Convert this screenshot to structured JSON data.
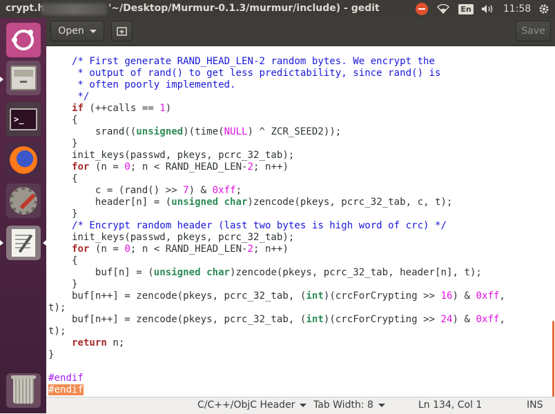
{
  "topbar": {
    "title_left": "crypt.h",
    "title_path": "'~/Desktop/Murmur-0.1.3/murmur/include) - gedit",
    "wifi_icon": "wifi-icon",
    "lang": "En",
    "volume_icon": "volume-icon",
    "clock": "11:58",
    "gear_icon": "gear-icon"
  },
  "toolbar": {
    "open_label": "Open",
    "new_icon": "new-tab-icon",
    "save_label": "Save"
  },
  "launcher": {
    "items": [
      "ubuntu-dash",
      "files",
      "terminal",
      "firefox",
      "system-settings",
      "text-editor",
      "trash"
    ]
  },
  "editor": {
    "lines": [
      [
        {
          "t": "    "
        },
        {
          "c": "cm",
          "t": "/* First generate RAND_HEAD_LEN-2 random bytes. We encrypt the"
        }
      ],
      [
        {
          "c": "cm",
          "t": "     * output of rand() to get less predictability, since rand() is"
        }
      ],
      [
        {
          "c": "cm",
          "t": "     * often poorly implemented."
        }
      ],
      [
        {
          "c": "cm",
          "t": "     */"
        }
      ],
      [
        {
          "t": "    "
        },
        {
          "c": "kw",
          "t": "if"
        },
        {
          "t": " (++calls == "
        },
        {
          "c": "nm",
          "t": "1"
        },
        {
          "t": ")"
        }
      ],
      [
        {
          "t": "    {"
        }
      ],
      [
        {
          "t": "        srand(("
        },
        {
          "c": "ty",
          "t": "unsigned"
        },
        {
          "t": ")(time("
        },
        {
          "c": "nm",
          "t": "NULL"
        },
        {
          "t": ") ^ ZCR_SEED2));"
        }
      ],
      [
        {
          "t": "    }"
        }
      ],
      [
        {
          "t": "    init_keys(passwd, pkeys, pcrc_32_tab);"
        }
      ],
      [
        {
          "t": "    "
        },
        {
          "c": "kw",
          "t": "for"
        },
        {
          "t": " (n = "
        },
        {
          "c": "nm",
          "t": "0"
        },
        {
          "t": "; n < RAND_HEAD_LEN-"
        },
        {
          "c": "nm",
          "t": "2"
        },
        {
          "t": "; n++)"
        }
      ],
      [
        {
          "t": "    {"
        }
      ],
      [
        {
          "t": "        c = (rand() >> "
        },
        {
          "c": "nm",
          "t": "7"
        },
        {
          "t": ") & "
        },
        {
          "c": "nm",
          "t": "0xff"
        },
        {
          "t": ";"
        }
      ],
      [
        {
          "t": "        header[n] = ("
        },
        {
          "c": "ty",
          "t": "unsigned char"
        },
        {
          "t": ")zencode(pkeys, pcrc_32_tab, c, t);"
        }
      ],
      [
        {
          "t": "    }"
        }
      ],
      [
        {
          "t": "    "
        },
        {
          "c": "cm",
          "t": "/* Encrypt random header (last two bytes is high word of crc) */"
        }
      ],
      [
        {
          "t": "    init_keys(passwd, pkeys, pcrc_32_tab);"
        }
      ],
      [
        {
          "t": "    "
        },
        {
          "c": "kw",
          "t": "for"
        },
        {
          "t": " (n = "
        },
        {
          "c": "nm",
          "t": "0"
        },
        {
          "t": "; n < RAND_HEAD_LEN-"
        },
        {
          "c": "nm",
          "t": "2"
        },
        {
          "t": "; n++)"
        }
      ],
      [
        {
          "t": "    {"
        }
      ],
      [
        {
          "t": "        buf[n] = ("
        },
        {
          "c": "ty",
          "t": "unsigned char"
        },
        {
          "t": ")zencode(pkeys, pcrc_32_tab, header[n], t);"
        }
      ],
      [
        {
          "t": "    }"
        }
      ],
      [
        {
          "t": "    buf[n++] = zencode(pkeys, pcrc_32_tab, ("
        },
        {
          "c": "ty",
          "t": "int"
        },
        {
          "t": ")(crcForCrypting >> "
        },
        {
          "c": "nm",
          "t": "16"
        },
        {
          "t": ") & "
        },
        {
          "c": "nm",
          "t": "0xff"
        },
        {
          "t": ","
        }
      ],
      [
        {
          "t": "t);"
        }
      ],
      [
        {
          "t": "    buf[n++] = zencode(pkeys, pcrc_32_tab, ("
        },
        {
          "c": "ty",
          "t": "int"
        },
        {
          "t": ")(crcForCrypting >> "
        },
        {
          "c": "nm",
          "t": "24"
        },
        {
          "t": ") & "
        },
        {
          "c": "nm",
          "t": "0xff"
        },
        {
          "t": ","
        }
      ],
      [
        {
          "t": "t);"
        }
      ],
      [
        {
          "t": "    "
        },
        {
          "c": "kw",
          "t": "return"
        },
        {
          "t": " n;"
        }
      ],
      [
        {
          "t": "}"
        }
      ],
      [
        {
          "t": ""
        }
      ],
      [
        {
          "c": "pp",
          "t": "#endif"
        }
      ],
      [
        {
          "c": "pp hl",
          "t": "#endif"
        }
      ]
    ]
  },
  "statusbar": {
    "language": "C/C++/ObjC Header",
    "tab_width": "Tab Width: 8",
    "position": "Ln 134, Col 1",
    "mode": "INS"
  },
  "colors": {
    "comment": "#1818d8",
    "keyword": "#a52a2a",
    "type": "#2e8b57",
    "number": "#e010e0",
    "preprocessor": "#a020f0",
    "highlight": "#f28b50",
    "launcher": "#4a2340",
    "panel": "#3c3b37"
  }
}
